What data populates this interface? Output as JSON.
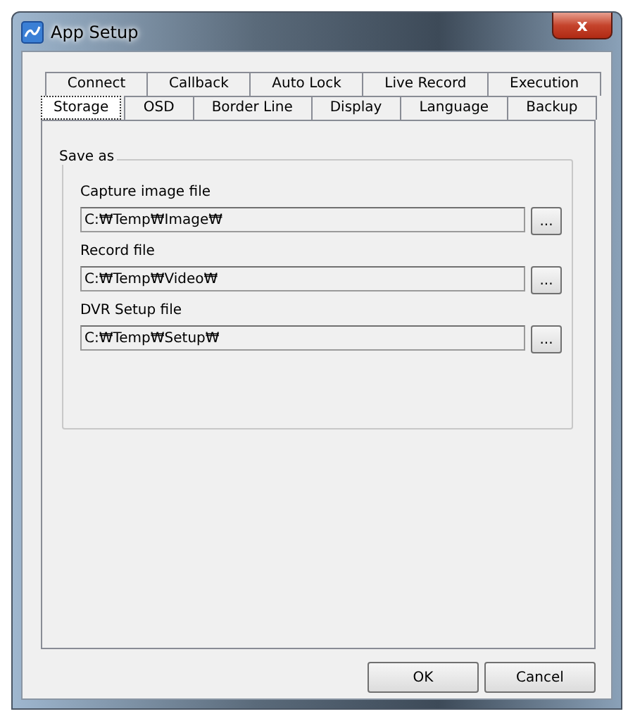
{
  "window": {
    "title": "App Setup",
    "close": "x"
  },
  "tab_rows": [
    [
      {
        "label": "Connect",
        "selected": false
      },
      {
        "label": "Callback",
        "selected": false
      },
      {
        "label": "Auto Lock",
        "selected": false
      },
      {
        "label": "Live Record",
        "selected": false
      },
      {
        "label": "Execution",
        "selected": false
      }
    ],
    [
      {
        "label": "Storage",
        "selected": true
      },
      {
        "label": "OSD",
        "selected": false
      },
      {
        "label": "Border Line",
        "selected": false
      },
      {
        "label": "Display",
        "selected": false
      },
      {
        "label": "Language",
        "selected": false
      },
      {
        "label": "Backup",
        "selected": false
      }
    ]
  ],
  "group": {
    "title": "Save as",
    "fields": [
      {
        "label": "Capture image file",
        "value": "C:₩Temp₩Image₩",
        "browse": "..."
      },
      {
        "label": "Record file",
        "value": "C:₩Temp₩Video₩",
        "browse": "..."
      },
      {
        "label": "DVR Setup file",
        "value": "C:₩Temp₩Setup₩",
        "browse": "..."
      }
    ]
  },
  "buttons": [
    "OK",
    "Cancel"
  ]
}
